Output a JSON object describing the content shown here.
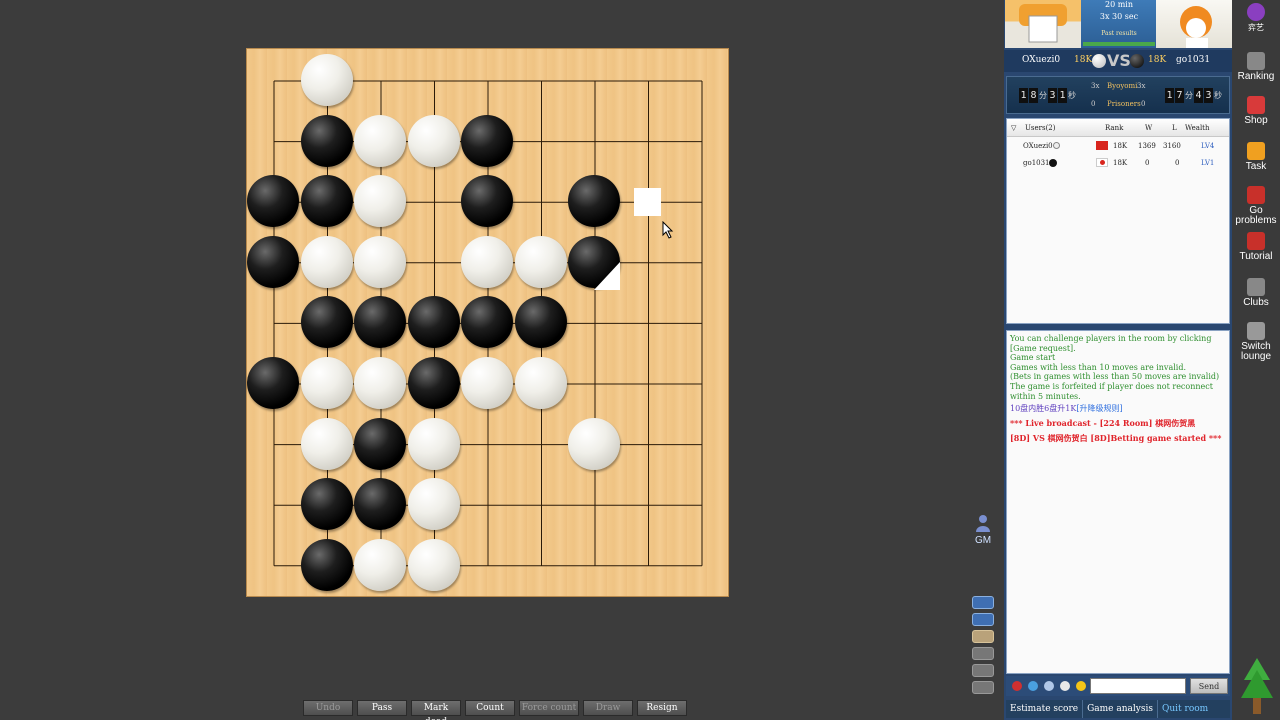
{
  "board": {
    "lines": 9,
    "last_move": "triangle marker on black stone",
    "cursor": "pointer at empty point",
    "stones": [
      {
        "color": "w",
        "col": 1,
        "row": 0
      },
      {
        "color": "b",
        "col": 1,
        "row": 1
      },
      {
        "color": "w",
        "col": 2,
        "row": 1
      },
      {
        "color": "w",
        "col": 3,
        "row": 1
      },
      {
        "color": "b",
        "col": 4,
        "row": 1
      },
      {
        "color": "b",
        "col": 0,
        "row": 2
      },
      {
        "color": "b",
        "col": 1,
        "row": 2
      },
      {
        "color": "w",
        "col": 2,
        "row": 2
      },
      {
        "color": "b",
        "col": 4,
        "row": 2
      },
      {
        "color": "b",
        "col": 6,
        "row": 2
      },
      {
        "color": "b",
        "col": 0,
        "row": 3
      },
      {
        "color": "w",
        "col": 1,
        "row": 3
      },
      {
        "color": "w",
        "col": 2,
        "row": 3
      },
      {
        "color": "w",
        "col": 4,
        "row": 3
      },
      {
        "color": "w",
        "col": 5,
        "row": 3
      },
      {
        "color": "b",
        "col": 6,
        "row": 3
      },
      {
        "color": "b",
        "col": 1,
        "row": 4
      },
      {
        "color": "b",
        "col": 2,
        "row": 4
      },
      {
        "color": "b",
        "col": 3,
        "row": 4
      },
      {
        "color": "b",
        "col": 4,
        "row": 4
      },
      {
        "color": "b",
        "col": 5,
        "row": 4
      },
      {
        "color": "b",
        "col": 0,
        "row": 5
      },
      {
        "color": "w",
        "col": 1,
        "row": 5
      },
      {
        "color": "w",
        "col": 2,
        "row": 5
      },
      {
        "color": "b",
        "col": 3,
        "row": 5
      },
      {
        "color": "w",
        "col": 4,
        "row": 5
      },
      {
        "color": "w",
        "col": 5,
        "row": 5
      },
      {
        "color": "w",
        "col": 1,
        "row": 6
      },
      {
        "color": "b",
        "col": 2,
        "row": 6
      },
      {
        "color": "w",
        "col": 3,
        "row": 6
      },
      {
        "color": "w",
        "col": 6,
        "row": 6
      },
      {
        "color": "b",
        "col": 1,
        "row": 7
      },
      {
        "color": "b",
        "col": 2,
        "row": 7
      },
      {
        "color": "w",
        "col": 3,
        "row": 7
      },
      {
        "color": "b",
        "col": 1,
        "row": 8
      },
      {
        "color": "w",
        "col": 2,
        "row": 8
      },
      {
        "color": "w",
        "col": 3,
        "row": 8
      }
    ]
  },
  "bottom_buttons": [
    {
      "label": "Undo",
      "enabled": false
    },
    {
      "label": "Pass",
      "enabled": true
    },
    {
      "label": "Mark dead",
      "enabled": true
    },
    {
      "label": "Count",
      "enabled": true
    },
    {
      "label": "Force count",
      "enabled": false
    },
    {
      "label": "Draw",
      "enabled": false
    },
    {
      "label": "Resign",
      "enabled": true
    }
  ],
  "time_box": {
    "line1": "20 min",
    "line2": "3x 30 sec",
    "line3": "Past results"
  },
  "players": {
    "white": {
      "name": "OXuezi0",
      "rank": "18K"
    },
    "black": {
      "name": "go1031",
      "rank": "18K"
    },
    "vs": "VS"
  },
  "clocks": {
    "left": [
      "1",
      "8",
      "分",
      "3",
      "1",
      "秒"
    ],
    "right": [
      "1",
      "7",
      "分",
      "4",
      "3",
      "秒"
    ],
    "mid": {
      "a": "3x",
      "b": "Byoyomi",
      "c": "3x",
      "d": "0",
      "e": "Prisoners",
      "f": "0"
    }
  },
  "users": {
    "title": "Users(2)",
    "headers": {
      "rank": "Rank",
      "w": "W",
      "l": "L",
      "wealth": "Wealth"
    },
    "rows": [
      {
        "name": "OXuezi0",
        "rank": "18K",
        "w": "1369",
        "l": "3160",
        "wealth": "LV4",
        "flag": "cn"
      },
      {
        "name": "go1031",
        "rank": "18K",
        "w": "0",
        "l": "0",
        "wealth": "LV1",
        "flag": "jp"
      }
    ]
  },
  "chat": {
    "sys1": "You can challenge players in the room by clicking [Game request].",
    "sys2": "Game start",
    "sys3": "Games with less than 10 moves are invalid.",
    "sys4": "(Bets in games with less than 50 moves are invalid)",
    "sys5": "The game is forfeited if player does not reconnect within 5 minutes.",
    "notice": "10盘内胜6盘升1K",
    "notice_link": "[升降级规则]",
    "live": "*** Live broadcast - [224 Room] 棋网伤贺黑",
    "bet": "[8D] VS 棋网伤贺白 [8D]Betting game started ***"
  },
  "chat_input": {
    "send": "Send"
  },
  "tabs": [
    "Estimate score",
    "Game analysis",
    "Quit room"
  ],
  "sidebar": [
    "弈艺",
    "Ranking",
    "Shop",
    "Task",
    "Go problems",
    "Tutorial",
    "Clubs",
    "Switch lounge"
  ],
  "gm": "GM"
}
